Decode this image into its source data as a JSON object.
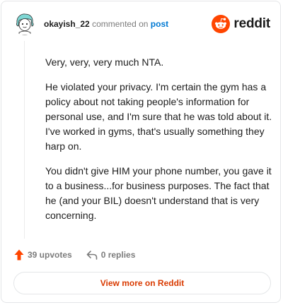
{
  "header": {
    "username": "okayish_22",
    "meta_text": "commented on",
    "post_link": "post",
    "brand_name": "reddit",
    "brand_color": "#ff4500"
  },
  "comment": {
    "paragraphs": [
      "Very, very, very much NTA.",
      "He violated your privacy. I'm certain the gym has a policy about not taking people's information for personal use, and I'm sure that he was told about it. I've worked in gyms, that's usually something they harp on.",
      "You didn't give HIM your phone number, you gave it to a business...for business purposes. The fact that he (and your BIL) doesn't understand that is very concerning."
    ]
  },
  "footer": {
    "upvotes_label": "39 upvotes",
    "replies_label": "0 replies",
    "upvote_icon": "upvote-arrow-icon",
    "reply_icon": "reply-arrow-icon",
    "upvote_color": "#ff4500"
  },
  "cta": {
    "view_more_label": "View more on Reddit",
    "color": "#d93a00"
  }
}
